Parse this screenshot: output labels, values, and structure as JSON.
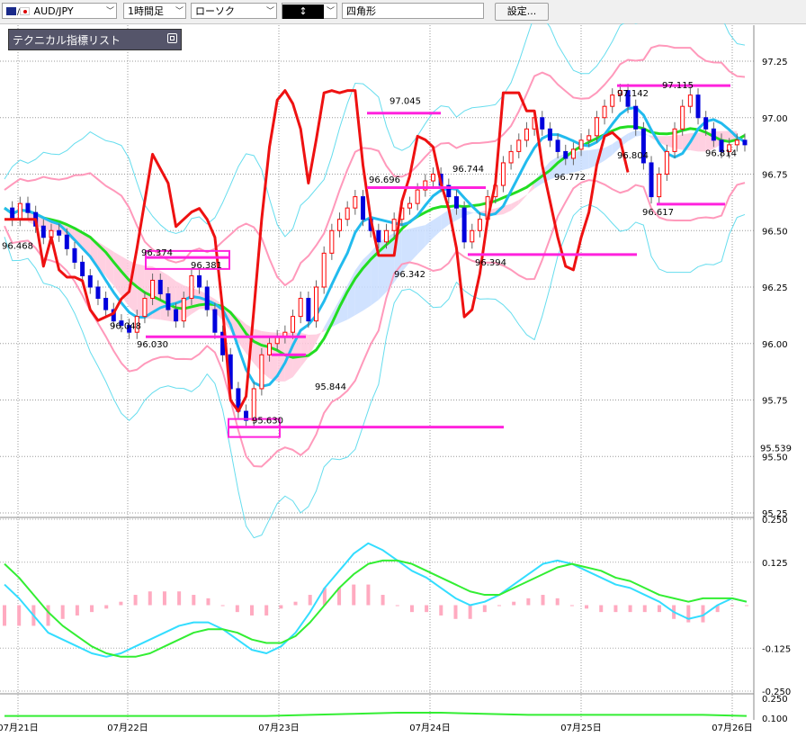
{
  "toolbar": {
    "symbol": "AUD/JPY",
    "timeframe": "1時間足",
    "chart_style": "ローソク",
    "draw_tool_icon": "cursor-icon",
    "shape": "四角形",
    "settings_label": "設定..."
  },
  "indicator_panel": {
    "title": "テクニカル指標リスト"
  },
  "colors": {
    "candle_up": "#ff0000",
    "candle_down": "#0000dd",
    "ma_green": "#22dd22",
    "ma_blue": "#22bbee",
    "bb_pink": "#ff99bb",
    "bb_cyan": "#66ddee",
    "cloud_pink": "#ffc8dc",
    "cloud_blue": "#c8ddff",
    "macd_line": "#33ddff",
    "signal_line": "#33ee33",
    "histogram": "#ffaac0",
    "rsi_red": "#ee1111",
    "marker_magenta": "#ff22dd"
  },
  "chart_data": [
    {
      "type": "candlestick",
      "ylim": [
        95.25,
        97.25
      ],
      "y_ticks": [
        "97.25",
        "97.00",
        "96.75",
        "96.50",
        "96.25",
        "96.00",
        "95.75",
        "95.50",
        "95.25"
      ],
      "current_price_label": "95.539",
      "x_ticks": [
        "07月21日",
        "07月22日",
        "07月23日",
        "07月24日",
        "07月25日",
        "07月26日"
      ],
      "close_approx": [
        96.6,
        96.55,
        96.62,
        96.58,
        96.52,
        96.47,
        96.5,
        96.48,
        96.42,
        96.36,
        96.3,
        96.25,
        96.2,
        96.15,
        96.1,
        96.08,
        96.05,
        96.12,
        96.2,
        96.28,
        96.22,
        96.15,
        96.1,
        96.2,
        96.3,
        96.25,
        96.15,
        96.05,
        95.95,
        95.8,
        95.7,
        95.66,
        95.8,
        95.95,
        96.0,
        96.03,
        96.05,
        96.12,
        96.2,
        96.1,
        96.25,
        96.4,
        96.5,
        96.55,
        96.6,
        96.65,
        96.55,
        96.5,
        96.45,
        96.5,
        96.55,
        96.6,
        96.62,
        96.68,
        96.72,
        96.75,
        96.7,
        96.65,
        96.6,
        96.45,
        96.5,
        96.55,
        96.65,
        96.7,
        96.8,
        96.85,
        96.9,
        96.95,
        97.0,
        96.95,
        96.9,
        96.85,
        96.82,
        96.86,
        96.9,
        96.92,
        97.0,
        97.05,
        97.1,
        97.12,
        97.05,
        96.95,
        96.8,
        96.65,
        96.75,
        96.85,
        96.95,
        97.05,
        97.1,
        97.0,
        96.95,
        96.9,
        96.85,
        96.88,
        96.9,
        96.88
      ],
      "annotations": [
        {
          "text": "96.468",
          "x_date": "07月21日",
          "y": 96.468
        },
        {
          "text": "96.048",
          "x_date": "07月22日",
          "y": 96.048
        },
        {
          "text": "96.030",
          "x_date": "07月22日",
          "y": 96.03
        },
        {
          "text": "96.374",
          "x_date": "07月22日",
          "y": 96.374
        },
        {
          "text": "96.381",
          "x_date": "07月22日",
          "y": 96.381
        },
        {
          "text": "95.630",
          "x_date": "07月23日",
          "y": 95.63
        },
        {
          "text": "95.844",
          "x_date": "07月23日",
          "y": 95.844
        },
        {
          "text": "96.696",
          "x_date": "07月23日",
          "y": 96.696
        },
        {
          "text": "96.342",
          "x_date": "07月24日",
          "y": 96.342
        },
        {
          "text": "96.744",
          "x_date": "07月24日",
          "y": 96.744
        },
        {
          "text": "96.394",
          "x_date": "07月24日",
          "y": 96.394
        },
        {
          "text": "97.045",
          "x_date": "07月24日",
          "y": 97.045
        },
        {
          "text": "96.772",
          "x_date": "07月25日",
          "y": 96.772
        },
        {
          "text": "96.804",
          "x_date": "07月25日",
          "y": 96.804
        },
        {
          "text": "97.142",
          "x_date": "07月25日",
          "y": 97.142
        },
        {
          "text": "97.115",
          "x_date": "07月25日",
          "y": 97.115
        },
        {
          "text": "96.617",
          "x_date": "07月25日",
          "y": 96.617
        },
        {
          "text": "96.814",
          "x_date": "07月26日",
          "y": 96.814
        }
      ]
    },
    {
      "type": "line",
      "panel": "MACD",
      "ylim": [
        -0.25,
        0.25
      ],
      "y_ticks": [
        "0.250",
        "0.125",
        "-0.125",
        "-0.250"
      ],
      "series": [
        {
          "values": [
            0.06,
            0.02,
            -0.03,
            -0.08,
            -0.1,
            -0.12,
            -0.14,
            -0.15,
            -0.14,
            -0.12,
            -0.1,
            -0.08,
            -0.06,
            -0.05,
            -0.05,
            -0.07,
            -0.1,
            -0.13,
            -0.14,
            -0.12,
            -0.08,
            -0.02,
            0.05,
            0.1,
            0.15,
            0.18,
            0.16,
            0.13,
            0.1,
            0.08,
            0.05,
            0.02,
            0.0,
            0.01,
            0.03,
            0.06,
            0.09,
            0.12,
            0.13,
            0.12,
            0.1,
            0.08,
            0.06,
            0.05,
            0.03,
            0.01,
            -0.02,
            -0.04,
            -0.03,
            0.0,
            0.02,
            0.01
          ]
        },
        {
          "values": [
            0.12,
            0.08,
            0.03,
            -0.02,
            -0.06,
            -0.09,
            -0.12,
            -0.14,
            -0.15,
            -0.15,
            -0.14,
            -0.12,
            -0.1,
            -0.08,
            -0.07,
            -0.07,
            -0.08,
            -0.1,
            -0.11,
            -0.11,
            -0.09,
            -0.05,
            0.0,
            0.05,
            0.09,
            0.12,
            0.13,
            0.13,
            0.12,
            0.1,
            0.08,
            0.06,
            0.04,
            0.03,
            0.03,
            0.05,
            0.07,
            0.09,
            0.11,
            0.12,
            0.11,
            0.1,
            0.08,
            0.07,
            0.05,
            0.03,
            0.02,
            0.01,
            0.02,
            0.02,
            0.02,
            0.01
          ]
        }
      ],
      "histogram": [
        -0.06,
        -0.06,
        -0.06,
        -0.06,
        -0.04,
        -0.03,
        -0.02,
        -0.01,
        0.01,
        0.03,
        0.04,
        0.04,
        0.04,
        0.03,
        0.02,
        0.0,
        -0.02,
        -0.03,
        -0.03,
        -0.01,
        0.01,
        0.03,
        0.05,
        0.05,
        0.06,
        0.06,
        0.03,
        0.0,
        -0.02,
        -0.02,
        -0.03,
        -0.04,
        -0.04,
        -0.02,
        0.0,
        0.01,
        0.02,
        0.03,
        0.02,
        0.0,
        -0.01,
        -0.02,
        -0.02,
        -0.02,
        -0.02,
        -0.02,
        -0.04,
        -0.05,
        -0.05,
        -0.02,
        0.0,
        0.0
      ]
    },
    {
      "type": "line",
      "panel": "oscillator",
      "y_ticks": [
        "0.250",
        "0.100"
      ],
      "series": [
        {
          "values": [
            0.12,
            0.12,
            0.12,
            0.12,
            0.12,
            0.12,
            0.12,
            0.13,
            0.14,
            0.15,
            0.15,
            0.14,
            0.13,
            0.13,
            0.13,
            0.13,
            0.13,
            0.12
          ]
        }
      ]
    }
  ]
}
